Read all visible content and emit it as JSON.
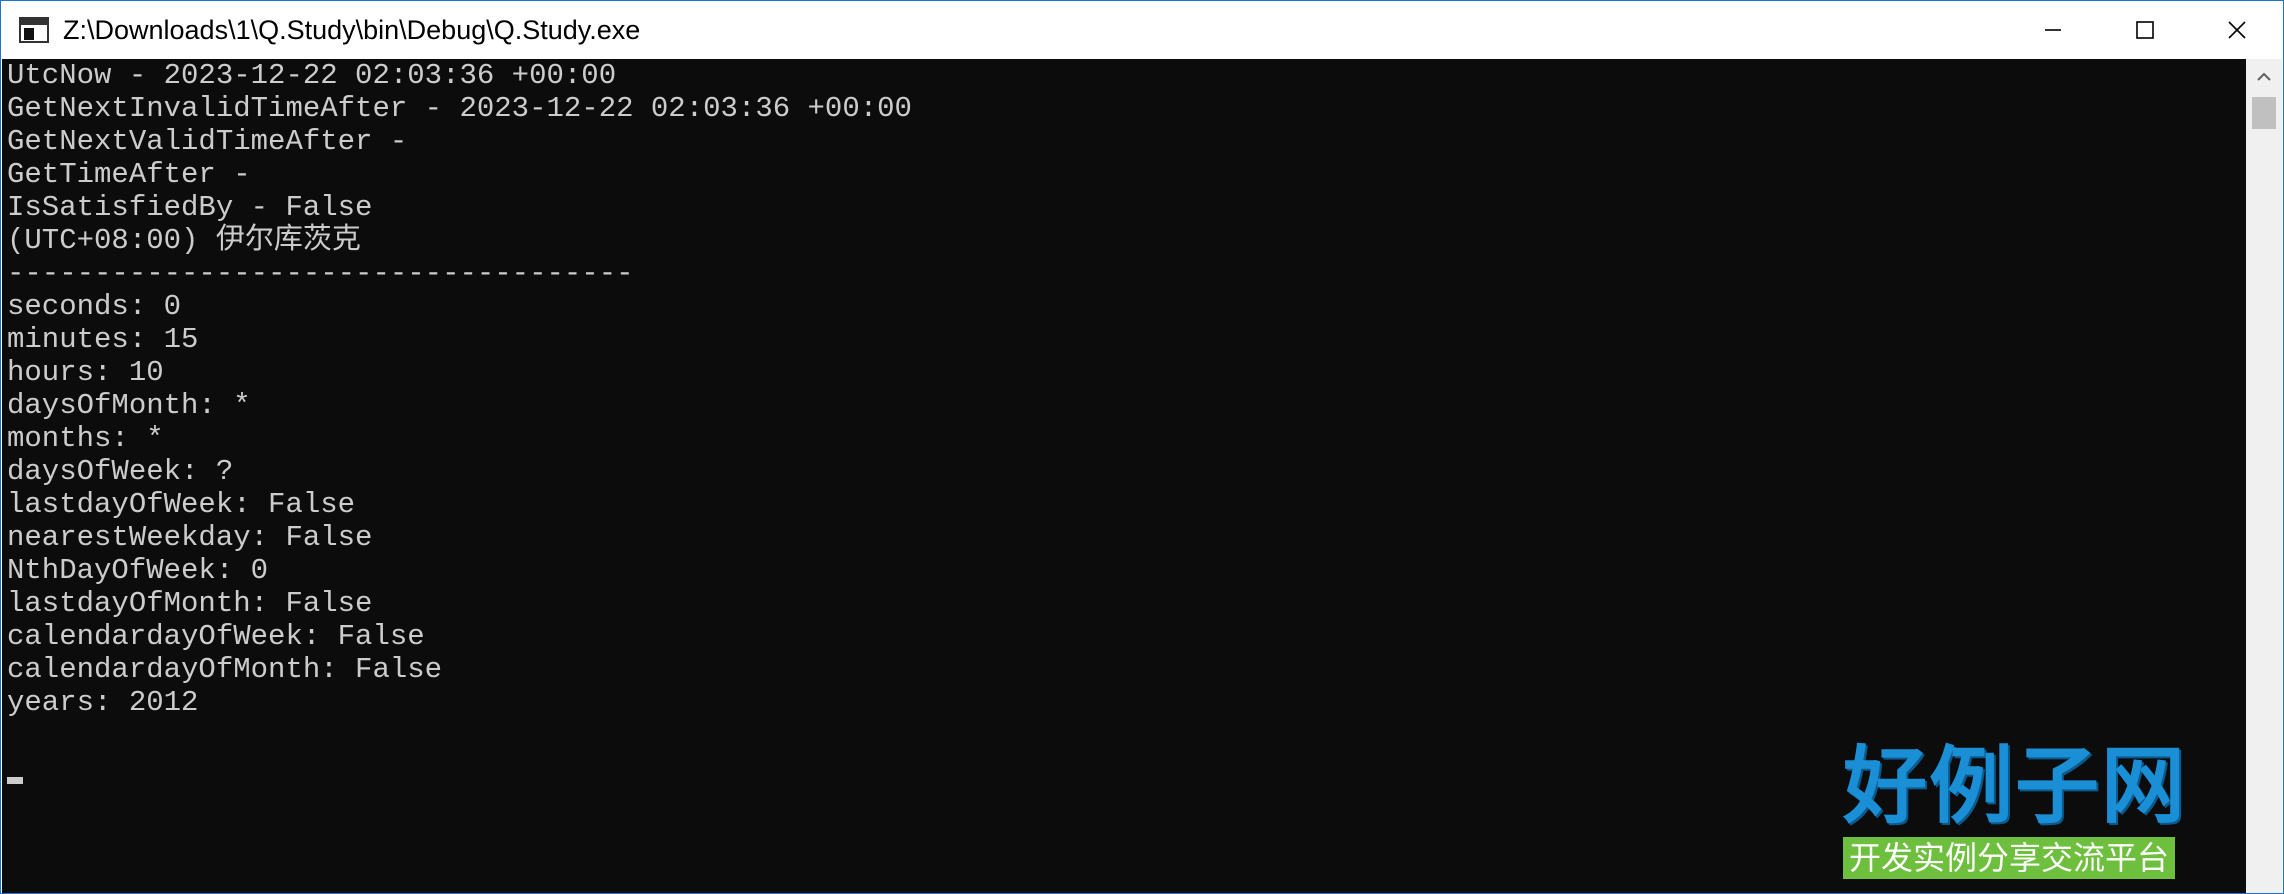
{
  "window": {
    "title": "Z:\\Downloads\\1\\Q.Study\\bin\\Debug\\Q.Study.exe"
  },
  "icons": {
    "app": "console-app-icon",
    "minimize": "minimize-icon",
    "maximize": "maximize-icon",
    "close": "close-icon",
    "scroll_up": "chevron-up-icon"
  },
  "console": {
    "lines": [
      "UtcNow - 2023-12-22 02:03:36 +00:00",
      "GetNextInvalidTimeAfter - 2023-12-22 02:03:36 +00:00",
      "GetNextValidTimeAfter -",
      "GetTimeAfter -",
      "IsSatisfiedBy - False",
      "(UTC+08:00) 伊尔库茨克",
      "------------------------------------",
      "seconds: 0",
      "minutes: 15",
      "hours: 10",
      "daysOfMonth: *",
      "months: *",
      "daysOfWeek: ?",
      "lastdayOfWeek: False",
      "nearestWeekday: False",
      "NthDayOfWeek: 0",
      "lastdayOfMonth: False",
      "calendardayOfWeek: False",
      "calendardayOfMonth: False",
      "years: 2012"
    ]
  },
  "watermark": {
    "title": "好例子网",
    "subtitle": "开发实例分享交流平台"
  },
  "colors": {
    "console_bg": "#0c0c0c",
    "console_text": "#cccccc",
    "window_border": "#1e73c7"
  }
}
